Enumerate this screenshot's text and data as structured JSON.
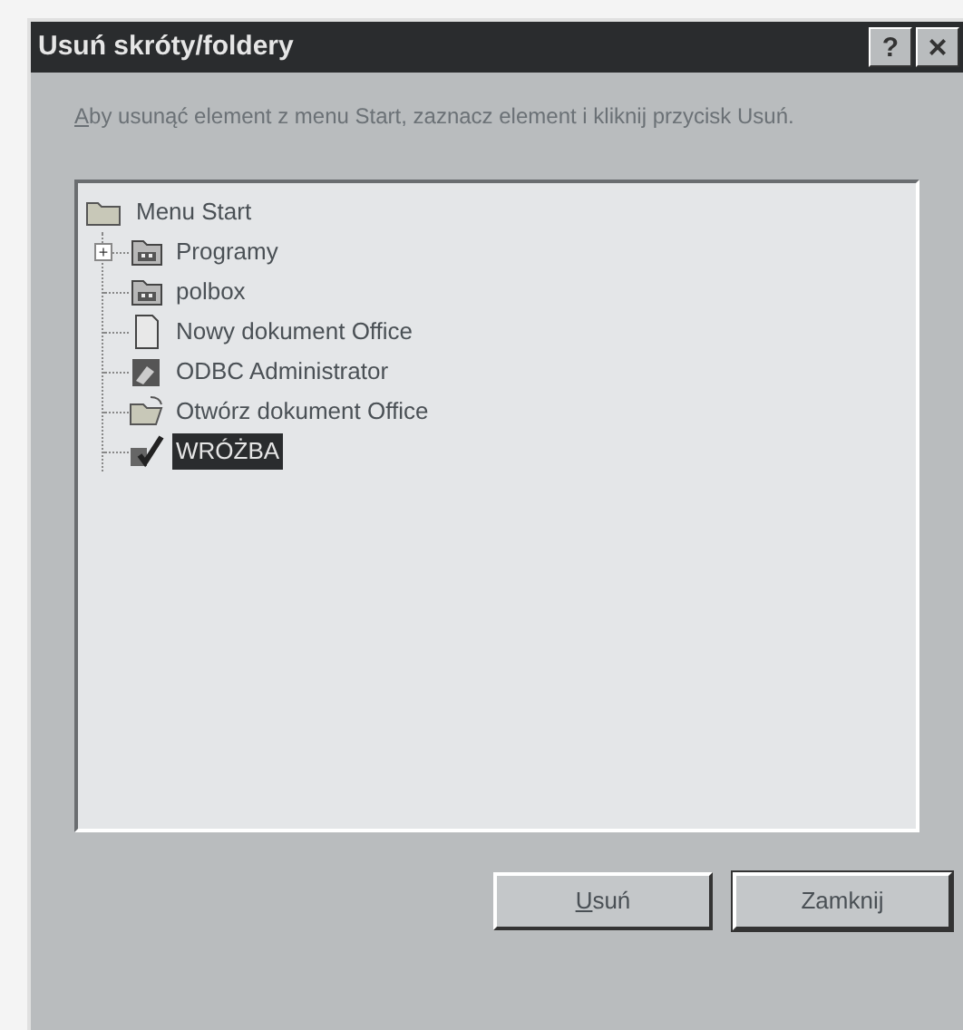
{
  "window": {
    "title": "Usuń skróty/foldery",
    "help_button": "?",
    "close_button": "×"
  },
  "instruction": {
    "text": "Aby usunąć element z menu Start, zaznacz element i kliknij przycisk Usuń.",
    "mnemonic_underlined": true
  },
  "tree": {
    "root": {
      "label": "Menu Start",
      "kind": "folder",
      "children": [
        {
          "label": "Programy",
          "kind": "group",
          "expander": "+",
          "selected": false
        },
        {
          "label": "polbox",
          "kind": "group",
          "selected": false
        },
        {
          "label": "Nowy dokument Office",
          "kind": "document",
          "selected": false
        },
        {
          "label": "ODBC Administrator",
          "kind": "tool",
          "selected": false
        },
        {
          "label": "Otwórz dokument Office",
          "kind": "open",
          "selected": false
        },
        {
          "label": "WRÓŻBA",
          "kind": "wand",
          "selected": true
        }
      ]
    }
  },
  "buttons": [
    {
      "label": "Usuń",
      "mnemonic_underlined": true,
      "default": false
    },
    {
      "label": "Zamknij",
      "mnemonic_underlined": false,
      "default": true
    }
  ]
}
